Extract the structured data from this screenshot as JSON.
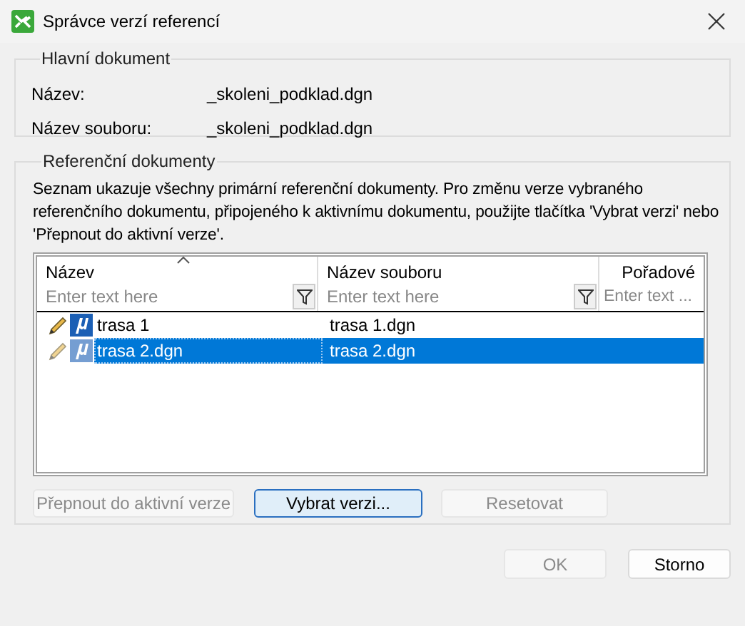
{
  "window": {
    "title": "Správce verzí referencí"
  },
  "main_document": {
    "title": "Hlavní dokument",
    "fields": [
      {
        "label": "Název:",
        "value": "_skoleni_podklad.dgn"
      },
      {
        "label": "Název souboru:",
        "value": "_skoleni_podklad.dgn"
      }
    ]
  },
  "references": {
    "title": "Referenční dokumenty",
    "description": "Seznam ukazuje všechny primární referenční dokumenty. Pro změnu verze vybraného referenčního dokumentu, připojeného k aktivnímu dokumentu, použijte tlačítka 'Vybrat verzi' nebo 'Přepnout do aktivní verze'.",
    "table": {
      "columns": [
        {
          "label": "Název",
          "placeholder": "Enter text here",
          "sorted": true,
          "filter": true
        },
        {
          "label": "Název souboru",
          "placeholder": "Enter text here",
          "sorted": false,
          "filter": true
        },
        {
          "label": "Pořadové",
          "placeholder": "Enter text ...",
          "sorted": false,
          "filter": false
        }
      ],
      "rows": [
        {
          "name": "trasa 1",
          "file": "trasa 1.dgn",
          "selected": false
        },
        {
          "name": "trasa 2.dgn",
          "file": "trasa 2.dgn",
          "selected": true
        }
      ]
    },
    "buttons": [
      {
        "label": "Přepnout do aktivní verze",
        "disabled": true,
        "focused": false
      },
      {
        "label": "Vybrat verzi...",
        "disabled": false,
        "focused": true
      },
      {
        "label": "Resetovat",
        "disabled": true,
        "focused": false
      }
    ]
  },
  "dialog_buttons": [
    {
      "label": "OK",
      "disabled": true
    },
    {
      "label": "Storno",
      "disabled": false
    }
  ]
}
